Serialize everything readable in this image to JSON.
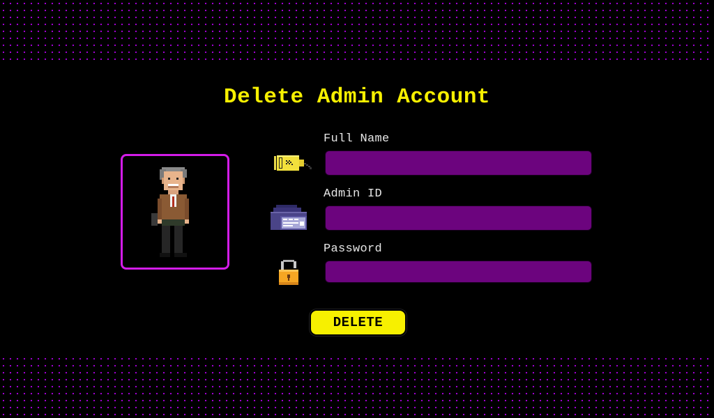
{
  "page": {
    "title": "Delete Admin Account"
  },
  "form": {
    "fields": [
      {
        "label": "Full Name",
        "value": "",
        "icon": "ticket-icon"
      },
      {
        "label": "Admin ID",
        "value": "",
        "icon": "id-card-icon"
      },
      {
        "label": "Password",
        "value": "",
        "icon": "lock-icon"
      }
    ],
    "submit_label": "DELETE"
  },
  "avatar": {
    "icon": "admin-avatar-pixel-art"
  },
  "colors": {
    "background": "#000000",
    "accent_yellow": "#f7f000",
    "accent_magenta": "#d31ce8",
    "input_fill": "#6c047e",
    "dot_pattern": "#b100e8"
  }
}
